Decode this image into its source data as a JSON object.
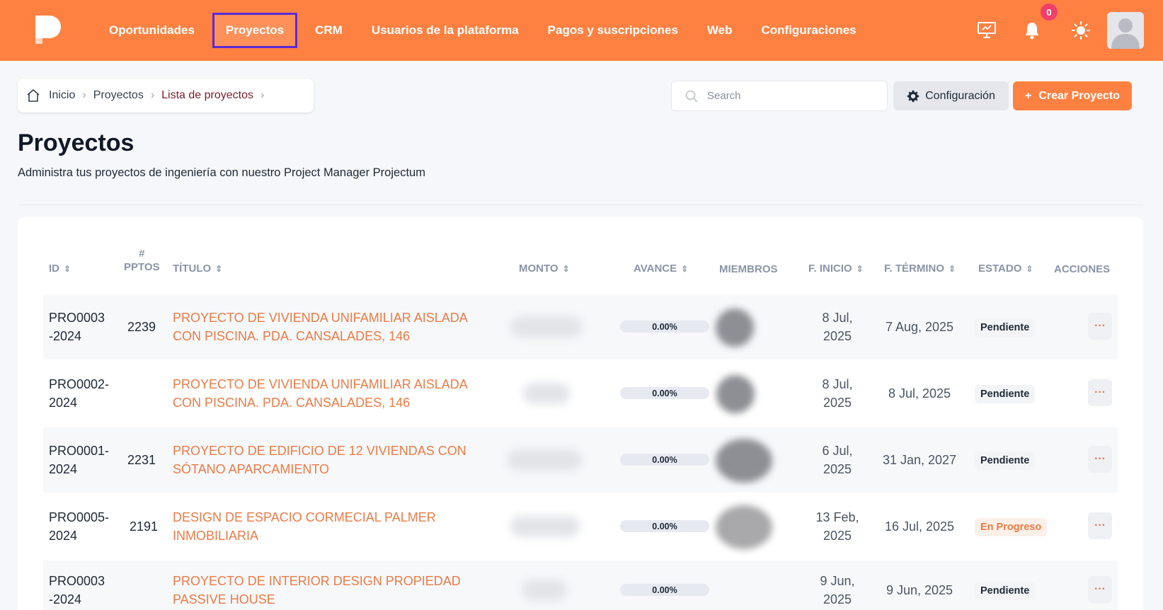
{
  "nav": {
    "items": [
      {
        "label": "Oportunidades",
        "active": false
      },
      {
        "label": "Proyectos",
        "active": true
      },
      {
        "label": "CRM",
        "active": false
      },
      {
        "label": "Usuarios de la plataforma",
        "active": false
      },
      {
        "label": "Pagos y suscripciones",
        "active": false
      },
      {
        "label": "Web",
        "active": false
      },
      {
        "label": "Configuraciones",
        "active": false
      }
    ],
    "notification_count": "0"
  },
  "breadcrumb": {
    "items": [
      "Inicio",
      "Proyectos",
      "Lista de proyectos"
    ]
  },
  "search": {
    "placeholder": "Search"
  },
  "buttons": {
    "config": "Configuración",
    "create": "Crear Proyecto",
    "create_prefix": "+",
    "more": "···"
  },
  "page": {
    "title": "Proyectos",
    "subtitle": "Administra tus proyectos de ingeniería con nuestro Project Manager Projectum"
  },
  "table": {
    "headers": {
      "id": "ID",
      "pptos_top": "#",
      "pptos_bottom": "PPTOS",
      "titulo": "TÍTULO",
      "monto": "MONTO",
      "avance": "AVANCE",
      "miembros": "MIEMBROS",
      "inicio": "F. INICIO",
      "termino": "F. TÉRMINO",
      "estado": "ESTADO",
      "acciones": "ACCIONES"
    },
    "sort_glyph": "⇕",
    "rows": [
      {
        "id_1": "PRO0003",
        "id_2": "-2024",
        "pptos": "2239",
        "title_1": "PROYECTO DE VIVIENDA UNIFAMILIAR AISLADA",
        "title_2": "CON PISCINA. PDA. CANSALADES, 146",
        "avance": "0.00%",
        "inicio_1": "8 Jul,",
        "inicio_2": "2025",
        "termino": "7 Aug, 2025",
        "estado": "Pendiente",
        "estado_kind": "pend"
      },
      {
        "id_1": "PRO0002-",
        "id_2": "2024",
        "pptos": "",
        "title_1": "PROYECTO DE VIVIENDA UNIFAMILIAR AISLADA",
        "title_2": "CON PISCINA. PDA. CANSALADES, 146",
        "avance": "0.00%",
        "inicio_1": "8 Jul,",
        "inicio_2": "2025",
        "termino": "8 Jul, 2025",
        "estado": "Pendiente",
        "estado_kind": "pend"
      },
      {
        "id_1": "PRO0001-",
        "id_2": "2024",
        "pptos": "2231",
        "title_1": "PROYECTO DE EDIFICIO DE 12 VIVIENDAS CON",
        "title_2": "SÓTANO APARCAMIENTO",
        "avance": "0.00%",
        "inicio_1": "6 Jul,",
        "inicio_2": "2025",
        "termino": "31 Jan, 2027",
        "estado": "Pendiente",
        "estado_kind": "pend"
      },
      {
        "id_1": "PRO0005-",
        "id_2": "2024",
        "pptos": "2191",
        "title_1": "DESIGN DE ESPACIO CORMECIAL PALMER",
        "title_2": "INMOBILIARIA",
        "avance": "0.00%",
        "inicio_1": "13 Feb,",
        "inicio_2": "2025",
        "termino": "16 Jul, 2025",
        "estado": "En Progreso",
        "estado_kind": "prog"
      },
      {
        "id_1": "PRO0003",
        "id_2": "-2024",
        "pptos": "",
        "title_1": "PROYECTO DE INTERIOR DESIGN PROPIEDAD",
        "title_2": "PASSIVE HOUSE",
        "avance": "0.00%",
        "inicio_1": "9 Jun,",
        "inicio_2": "2025",
        "termino": "9 Jun, 2025",
        "estado": "Pendiente",
        "estado_kind": "pend"
      }
    ]
  },
  "colors": {
    "brand": "#ff8142",
    "active_outline": "#5b2bd6",
    "link": "#ee7a45",
    "badge": "#ef3f6b"
  }
}
